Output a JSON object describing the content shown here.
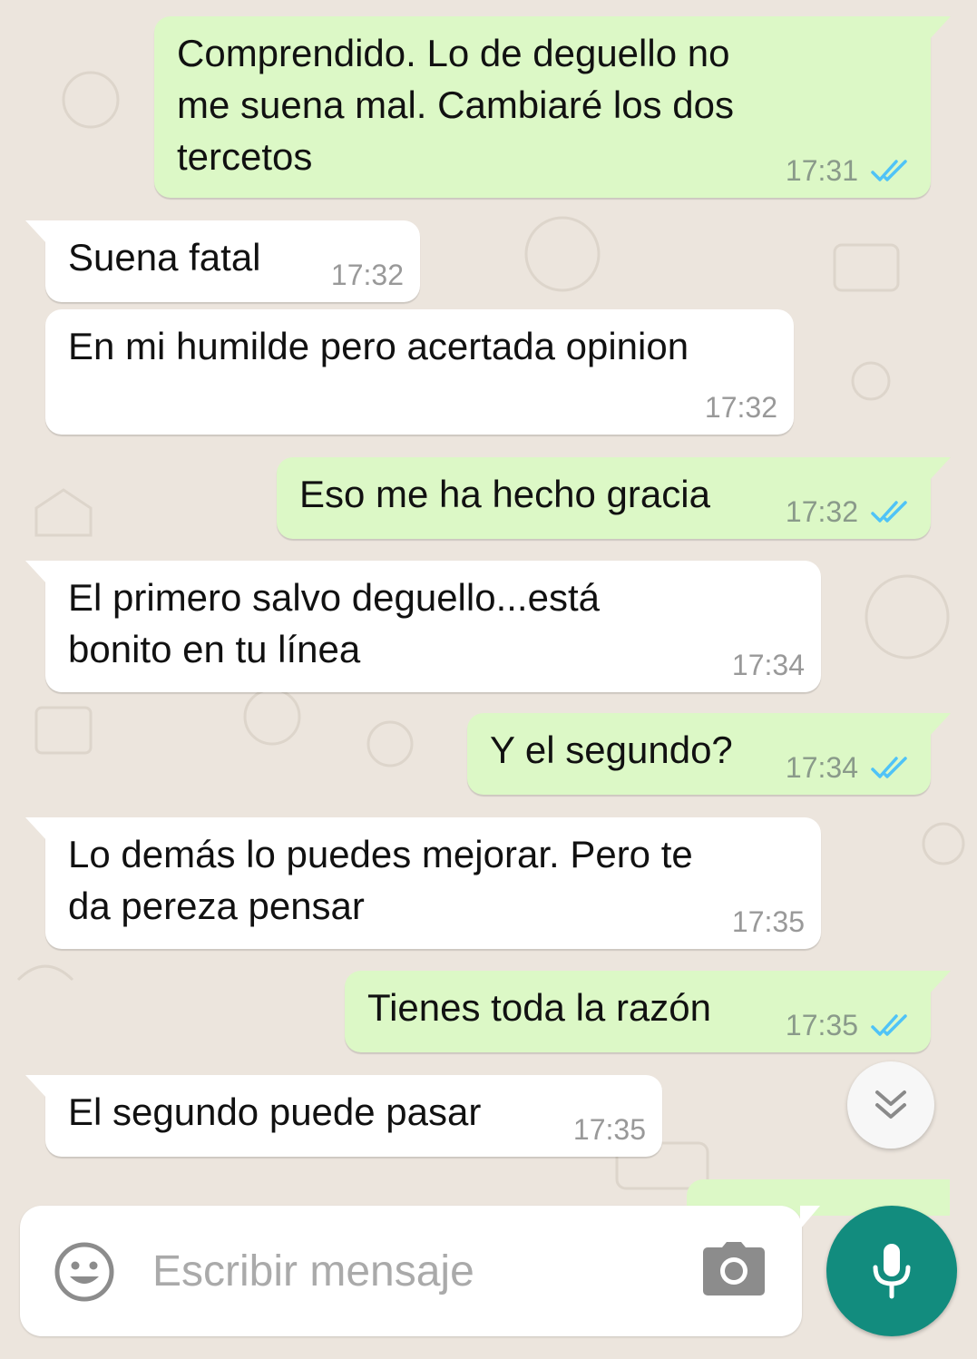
{
  "messages": [
    {
      "direction": "outgoing",
      "text": "Comprendido. Lo de deguello no\nme suena mal. Cambiaré los dos\ntercetos",
      "time": "17:31",
      "read": true
    },
    {
      "direction": "incoming",
      "text": "Suena fatal",
      "time": "17:32"
    },
    {
      "direction": "incoming",
      "text": "En mi humilde pero acertada opinion",
      "time": "17:32"
    },
    {
      "direction": "outgoing",
      "text": "Eso me ha hecho gracia",
      "time": "17:32",
      "read": true
    },
    {
      "direction": "incoming",
      "text": "El primero salvo deguello...está\nbonito en tu línea",
      "time": "17:34"
    },
    {
      "direction": "outgoing",
      "text": "Y el segundo?",
      "time": "17:34",
      "read": true
    },
    {
      "direction": "incoming",
      "text": "Lo demás lo puedes mejorar.  Pero te\nda pereza pensar",
      "time": "17:35"
    },
    {
      "direction": "outgoing",
      "text": "Tienes toda la razón",
      "time": "17:35",
      "read": true
    },
    {
      "direction": "incoming",
      "text": "El segundo puede pasar",
      "time": "17:35"
    }
  ],
  "composer": {
    "placeholder": "Escribir mensaje",
    "emoji_icon": "emoji-icon",
    "camera_icon": "camera-icon",
    "mic_icon": "microphone-icon"
  },
  "scroll_down_icon": "double-chevron-down-icon",
  "colors": {
    "background": "#ECE5DD",
    "outgoing_bubble": "#DCF8C6",
    "incoming_bubble": "#FFFFFF",
    "read_ticks": "#4FC3F7",
    "accent": "#128C7E"
  }
}
